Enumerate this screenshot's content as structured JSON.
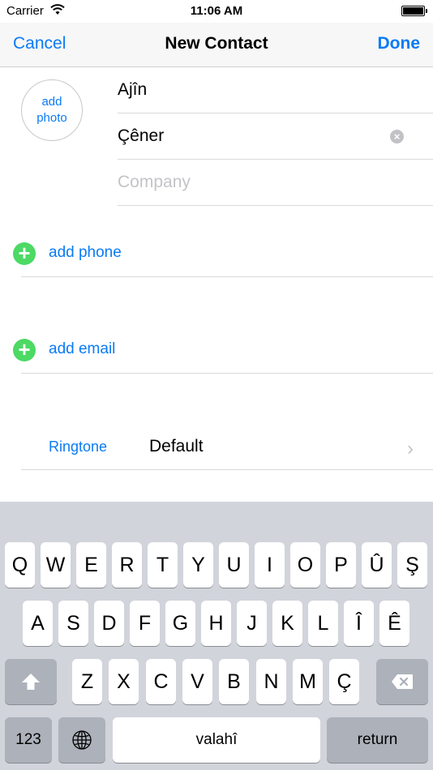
{
  "status_bar": {
    "carrier": "Carrier",
    "time": "11:06 AM"
  },
  "nav": {
    "cancel": "Cancel",
    "title": "New Contact",
    "done": "Done"
  },
  "photo": {
    "line1": "add",
    "line2": "photo"
  },
  "fields": {
    "first_name": "Ajîn",
    "last_name": "Çêner",
    "company_placeholder": "Company"
  },
  "add_phone": "add phone",
  "add_email": "add email",
  "ringtone": {
    "label": "Ringtone",
    "value": "Default"
  },
  "keyboard": {
    "row1": [
      "Q",
      "W",
      "E",
      "R",
      "T",
      "Y",
      "U",
      "I",
      "O",
      "P",
      "Û",
      "Ş"
    ],
    "row2": [
      "A",
      "S",
      "D",
      "F",
      "G",
      "H",
      "J",
      "K",
      "L",
      "Î",
      "Ê"
    ],
    "row3": [
      "Z",
      "X",
      "C",
      "V",
      "B",
      "N",
      "M",
      "Ç"
    ],
    "numbers": "123",
    "space": "valahî",
    "return": "return"
  },
  "colors": {
    "accent": "#0a7bf5",
    "add": "#4cd964"
  }
}
